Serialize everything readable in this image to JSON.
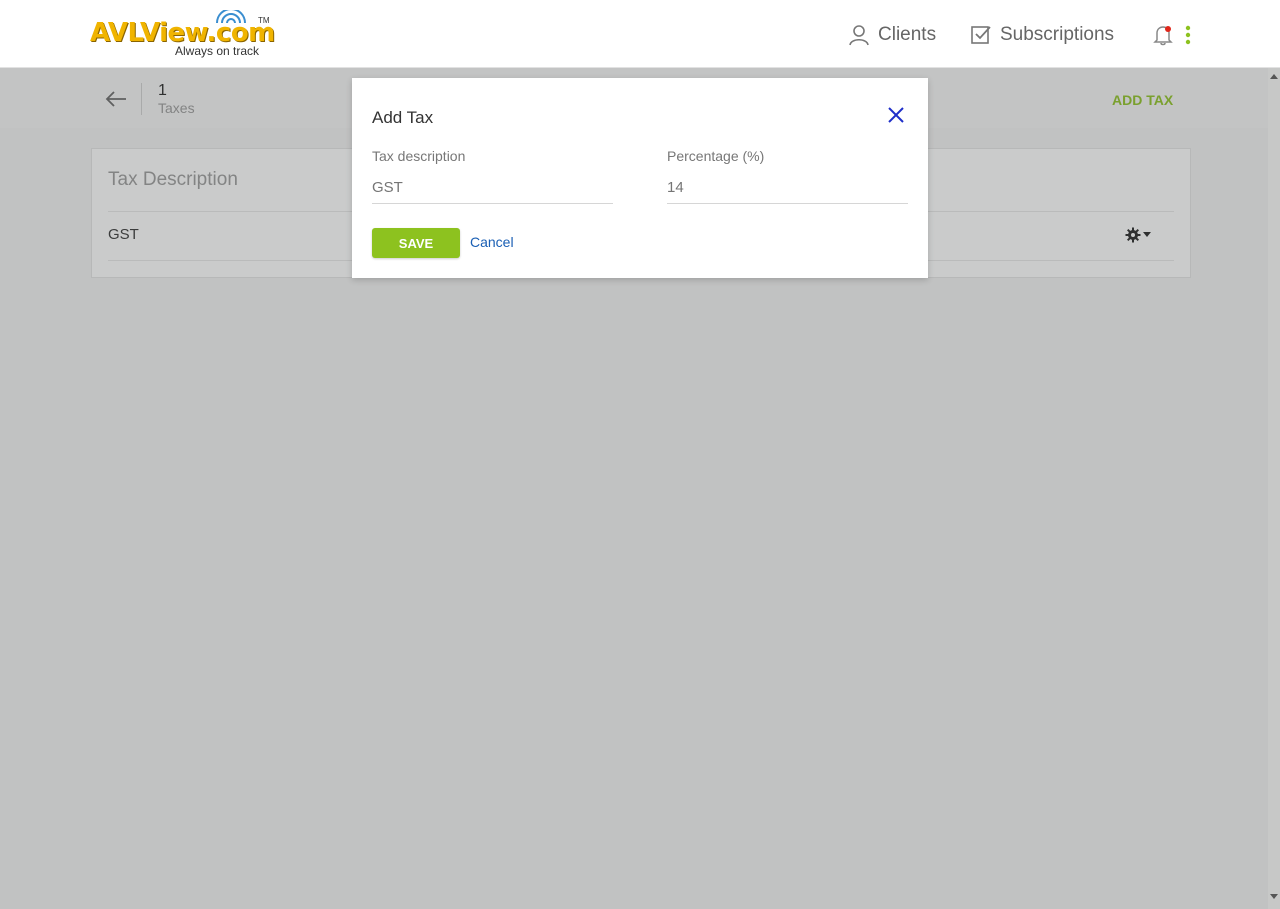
{
  "header": {
    "logo": {
      "brand": "AVLView.com",
      "tagline": "Always on track",
      "tm": "TM",
      "icon": "wifi-waves-icon"
    },
    "nav": [
      {
        "label": "Clients",
        "icon": "user-icon"
      },
      {
        "label": "Subscriptions",
        "icon": "checkbox-icon"
      }
    ],
    "notifications_icon": "bell-icon",
    "menu_icon": "kebab-menu-icon",
    "accent_color": "#8dc21f"
  },
  "subheader": {
    "back_icon": "arrow-left-icon",
    "count": "1",
    "count_label": "Taxes",
    "action_label": "ADD TAX"
  },
  "table": {
    "column_header": "Tax Description",
    "rows": [
      {
        "description": "GST",
        "actions_icon": "gear-icon"
      }
    ]
  },
  "modal": {
    "title": "Add Tax",
    "close_icon": "close-icon",
    "fields": {
      "description": {
        "label": "Tax description",
        "placeholder": "GST"
      },
      "percentage": {
        "label": "Percentage (%)",
        "placeholder": "14"
      }
    },
    "save_label": "SAVE",
    "cancel_label": "Cancel"
  }
}
